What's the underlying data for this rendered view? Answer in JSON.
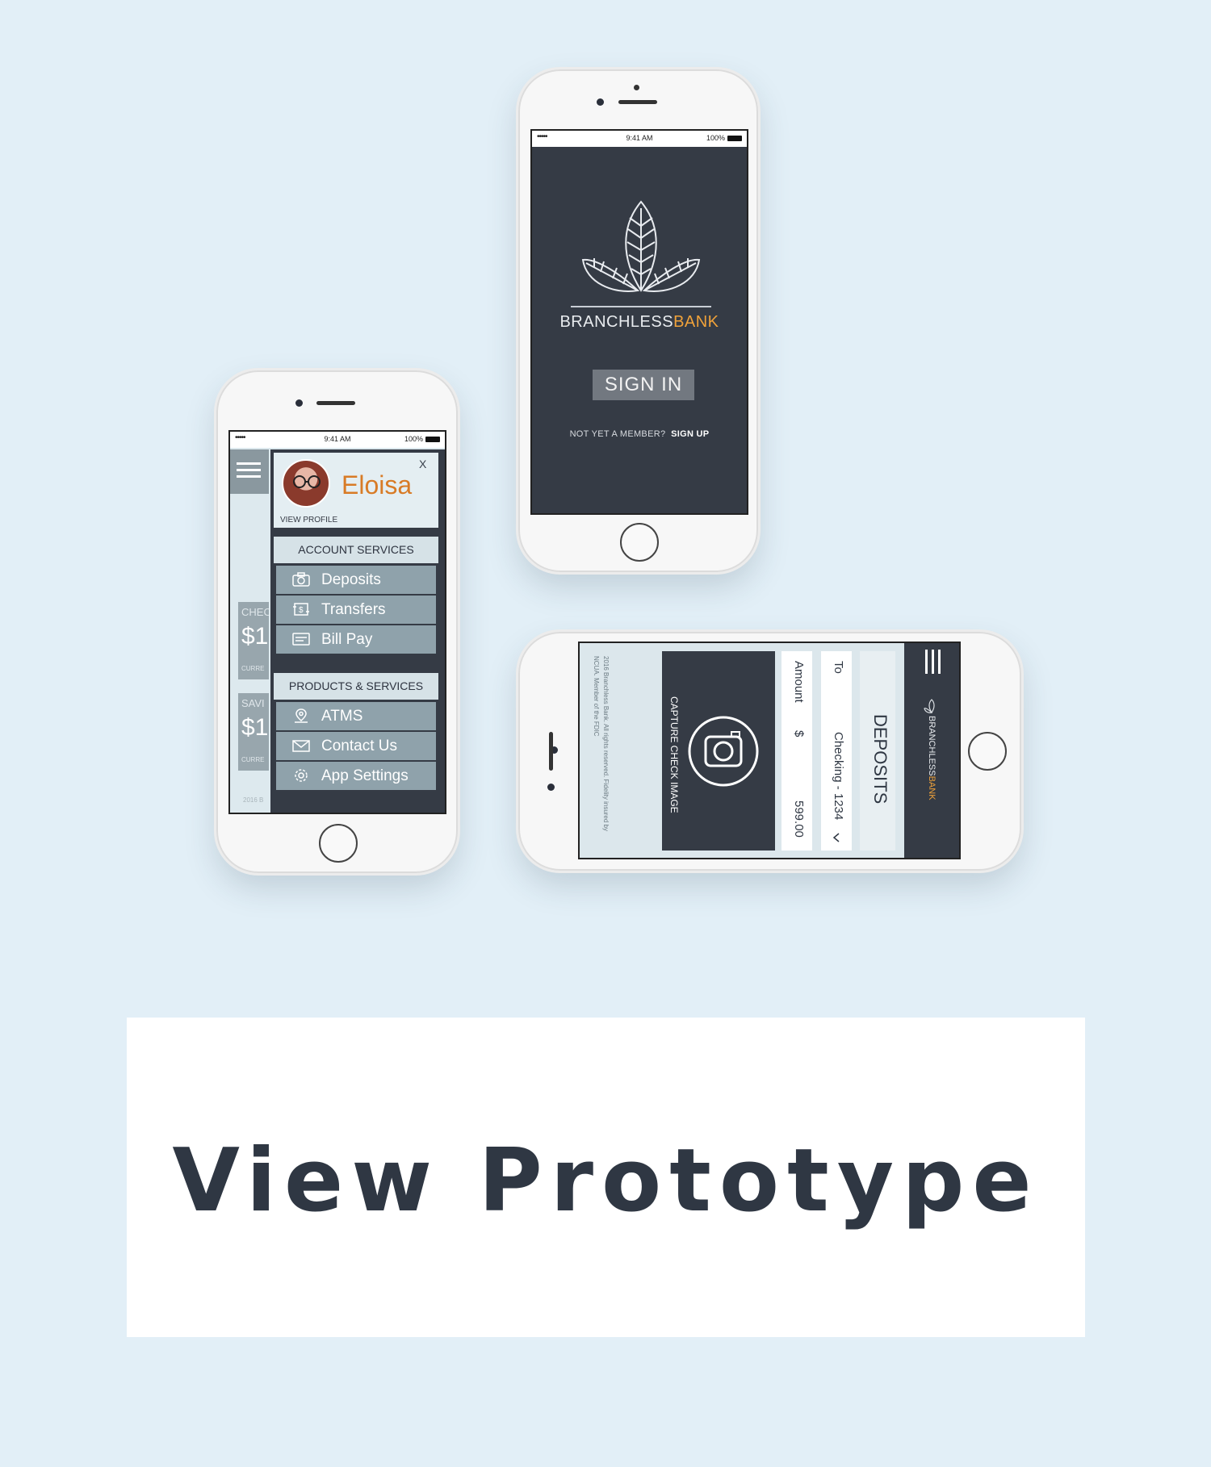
{
  "status_bar": {
    "time": "9:41 AM",
    "battery": "100%",
    "signal": "•••••"
  },
  "signin": {
    "brand_primary": "BRANCHLESS",
    "brand_accent": "BANK",
    "sign_in_label": "SIGN IN",
    "not_member": "NOT YET A MEMBER?",
    "sign_up_label": "SIGN UP"
  },
  "menu": {
    "user_name": "Eloisa",
    "view_profile": "VIEW PROFILE",
    "close": "X",
    "account_services": {
      "title": "ACCOUNT SERVICES",
      "items": [
        "Deposits",
        "Transfers",
        "Bill Pay"
      ]
    },
    "products_services": {
      "title": "PRODUCTS & SERVICES",
      "items": [
        "ATMS",
        "Contact Us",
        "App Settings"
      ]
    },
    "behind": {
      "checking": "CHEC",
      "savings": "SAVI",
      "dollar": "$1",
      "current": "CURRE",
      "footer": "2016 B"
    }
  },
  "deposits": {
    "title": "DEPOSITS",
    "brand_primary": "BRANCHLESS",
    "brand_accent": "BANK",
    "to_label": "To",
    "to_value": "Checking - 1234",
    "amount_label": "Amount",
    "currency": "$",
    "amount_value": "599.00",
    "capture_label": "CAPTURE CHECK IMAGE",
    "legal": "2016 Branchless Bank. All rights reserved. Fidelity insured by NCUA. Member of the FDIC"
  },
  "cta": {
    "label": "View Prototype"
  },
  "colors": {
    "dark": "#353b45",
    "accent": "#f0a23a",
    "orange_name": "#d87b26",
    "background": "#e2eff7",
    "menu_item": "#8fa2ab"
  }
}
